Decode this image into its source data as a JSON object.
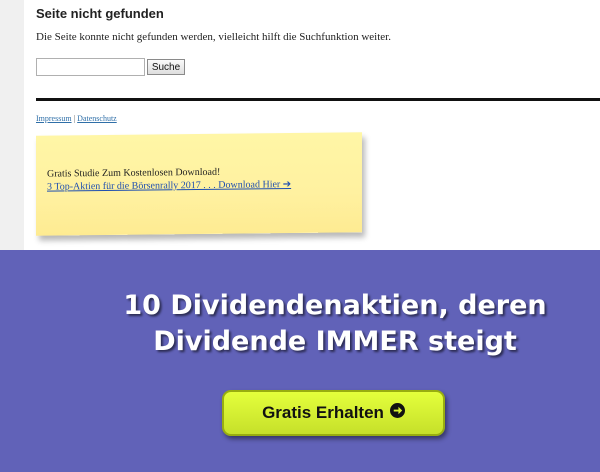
{
  "page": {
    "title": "Seite nicht gefunden",
    "description": "Die Seite konnte nicht gefunden werden, vielleicht hilft die Suchfunktion weiter."
  },
  "search": {
    "value": "",
    "placeholder": "",
    "button_label": "Suche"
  },
  "footer": {
    "links": [
      "Impressum",
      "Datenschutz"
    ],
    "separator": "|"
  },
  "sticky_note": {
    "line1": "Gratis Studie Zum Kostenlosen Download!",
    "link_text": "3 Top-Aktien für die Börsenrally 2017 . . . Download Hier ➔"
  },
  "banner": {
    "headline_line1": "10 Dividendenaktien, deren",
    "headline_line2": "Dividende IMMER steigt",
    "cta_label": "Gratis Erhalten",
    "cta_icon": "arrow-right-icon",
    "background_color": "#6162b8",
    "button_color": "#d6f231"
  }
}
